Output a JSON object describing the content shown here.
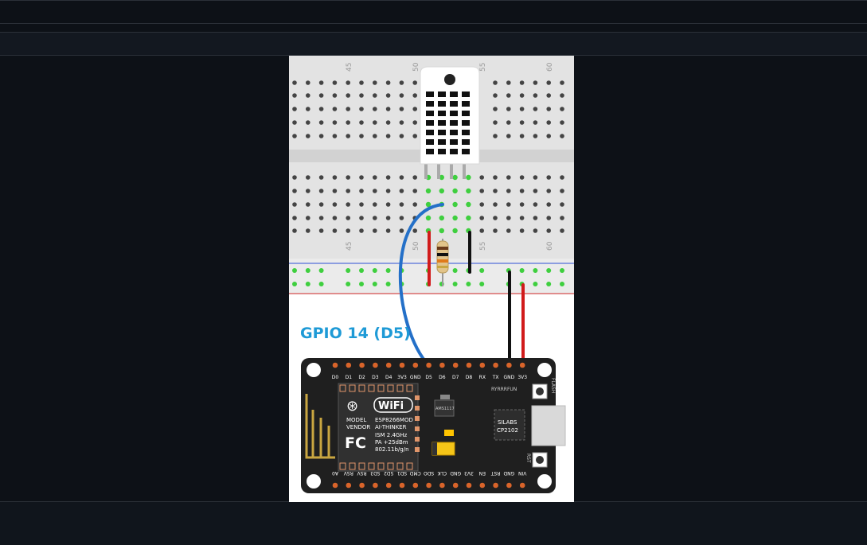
{
  "diagram": {
    "gpio_label": "GPIO 14 (D5)",
    "breadboard_numbers": [
      "45",
      "50",
      "55",
      "60"
    ],
    "top_pins": [
      "D0",
      "D1",
      "D2",
      "D3",
      "D4",
      "3V3",
      "GND",
      "D5",
      "D6",
      "D7",
      "D8",
      "RX",
      "TX",
      "GND",
      "3V3"
    ],
    "bottom_pins": [
      "A0",
      "RSV",
      "RSV",
      "SD3",
      "SD2",
      "SD1",
      "CMD",
      "SDO",
      "CLK",
      "GND",
      "3V3",
      "EN",
      "RST",
      "GND",
      "VIN"
    ],
    "module": {
      "wifi_text": "WiFi",
      "line1_left": "MODEL",
      "line1_right": "ESP8266MOD",
      "line2_left": "VENDOR",
      "line2_right": "AI-THINKER",
      "line3": "ISM 2.4GHz",
      "line4": "PA +25dBm",
      "line5": "802.11b/g/n",
      "fc": "FC",
      "ams": "AMS1117",
      "brand": "RYRRRFUN",
      "chip1": "SILABS",
      "chip2": "CP2102",
      "flash": "FLASH",
      "rst": "RST"
    }
  }
}
